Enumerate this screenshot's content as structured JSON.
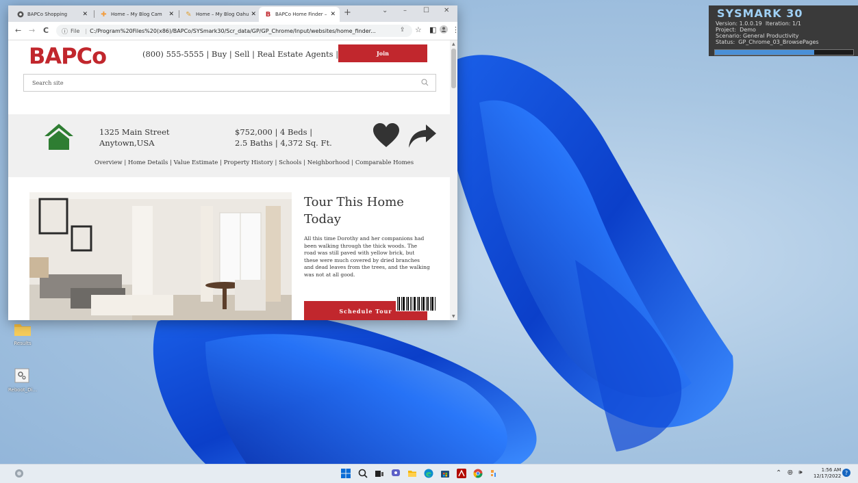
{
  "sysmark": {
    "title": "SYSMARK 30",
    "version_label": "Version:",
    "version": "1.0.0.19",
    "iteration_label": "Iteration:",
    "iteration": "1/1",
    "project_label": "Project:",
    "project": "Demo",
    "scenario_label": "Scenario:",
    "scenario": "General Productivity",
    "status_label": "Status:",
    "status": "GP_Chrome_03_BrowsePages",
    "progress": 0.72
  },
  "desktop_icons": [
    {
      "label": "Results",
      "icon": "folder-icon"
    },
    {
      "label": "Reboot_Di...",
      "icon": "settings-app-icon"
    }
  ],
  "browser": {
    "tabs": [
      {
        "title": "BAPCo Shopping",
        "icon": "chrome-icon"
      },
      {
        "title": "Home – My Blog Cam",
        "icon": "blog-icon"
      },
      {
        "title": "Home – My Blog Oahu",
        "icon": "blog-icon"
      },
      {
        "title": "BAPCo Home Finder –",
        "icon": "bapco-icon",
        "active": true
      }
    ],
    "new_tab": "+",
    "win_controls": {
      "dropdown": "⌄",
      "minimize": "–",
      "maximize": "☐",
      "close": "✕"
    },
    "nav": {
      "back": "←",
      "forward": "→",
      "reload": "C"
    },
    "address": {
      "scheme": "File",
      "url": "C:/Program%20Files%20(x86)/BAPCo/SYSmark30/Scr_data/GP/GP_Chrome/Input/websites/home_finder..."
    }
  },
  "site": {
    "logo": "BAPCo",
    "topnav": "(800) 555-5555 | Buy | Sell | Real Estate Agents | Sign In",
    "join": "Join",
    "search_placeholder": "Search site",
    "address_line1": "1325 Main Street",
    "address_line2": "Anytown,USA",
    "price_line1": "$752,000 | 4 Beds |",
    "price_line2": "2.5 Baths | 4,372 Sq. Ft.",
    "subnav": "Overview | Home Details | Value Estimate | Property History | Schools | Neighborhood | Comparable Homes",
    "tour_heading_1": "Tour This Home",
    "tour_heading_2": "Today",
    "tour_text": "All this time Dorothy and her companions had been walking through the thick woods. The road was still paved with yellow brick, but these were much covered by dried branches and dead leaves from the trees, and the walking was not at all good.",
    "schedule": "Schedule Tour"
  },
  "taskbar": {
    "apps": [
      "start-icon",
      "search-icon",
      "task-view-icon",
      "chat-icon",
      "file-explorer-icon",
      "edge-icon",
      "store-icon",
      "acrobat-icon",
      "chrome-icon",
      "app-icon"
    ],
    "time": "1:56 AM",
    "date": "12/17/2022"
  },
  "colors": {
    "brand_red": "#c1272d",
    "house_green": "#2e7d32"
  }
}
